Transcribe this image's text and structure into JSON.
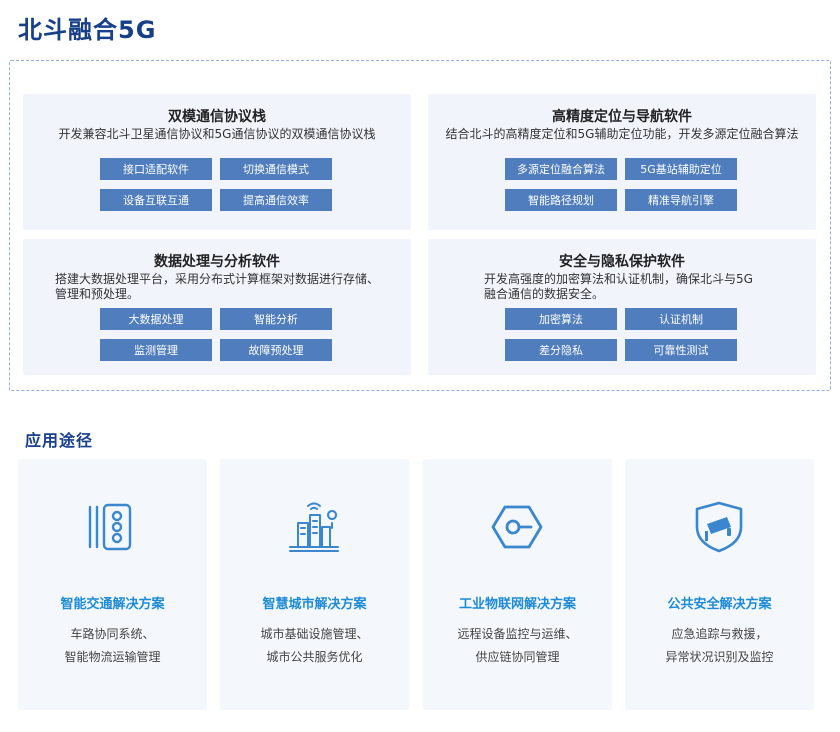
{
  "page": {
    "title": "北斗融合5G"
  },
  "modules": [
    {
      "title": "双模通信协议栈",
      "desc": "开发兼容北斗卫星通信协议和5G通信协议的双模通信协议栈",
      "tags": [
        "接口适配软件",
        "切换通信模式",
        "设备互联互通",
        "提高通信效率"
      ]
    },
    {
      "title": "高精度定位与导航软件",
      "desc": "结合北斗的高精度定位和5G辅助定位功能，开发多源定位融合算法",
      "tags": [
        "多源定位融合算法",
        "5G基站辅助定位",
        "智能路径规划",
        "精准导航引擎"
      ]
    },
    {
      "title": "数据处理与分析软件",
      "desc_lines": [
        "搭建大数据处理平台，采用分布式计算框架对数据进行存储、",
        "管理和预处理。"
      ],
      "tags": [
        "大数据处理",
        "智能分析",
        "监测管理",
        "故障预处理"
      ]
    },
    {
      "title": "安全与隐私保护软件",
      "desc_lines": [
        "开发高强度的加密算法和认证机制，确保北斗与5G",
        "融合通信的数据安全。"
      ],
      "tags": [
        "加密算法",
        "认证机制",
        "差分隐私",
        "可靠性测试"
      ]
    }
  ],
  "applications": {
    "title": "应用途径",
    "cards": [
      {
        "icon": "traffic-light-icon",
        "title": "智能交通解决方案",
        "lines": [
          "车路协同系统、",
          "智能物流运输管理"
        ]
      },
      {
        "icon": "smart-city-icon",
        "title": "智慧城市解决方案",
        "lines": [
          "城市基础设施管理、",
          "城市公共服务优化"
        ]
      },
      {
        "icon": "iot-hexagon-icon",
        "title": "工业物联网解决方案",
        "lines": [
          "远程设备监控与运维、",
          "供应链协同管理"
        ]
      },
      {
        "icon": "security-camera-shield-icon",
        "title": "公共安全解决方案",
        "lines": [
          "应急追踪与救援，",
          "异常状况识别及监控"
        ]
      }
    ]
  },
  "colors": {
    "title": "#173f8a",
    "tag_bg": "#4f7dbe",
    "card_title": "#1d8bd8",
    "icon": "#3a86cf"
  }
}
